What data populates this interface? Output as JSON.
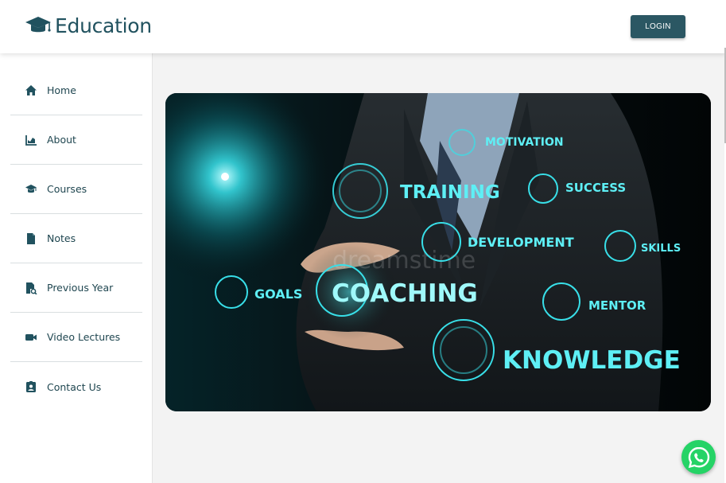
{
  "header": {
    "brand_title": "Education",
    "login_label": "LOGIN"
  },
  "sidebar": {
    "items": [
      {
        "label": "Home",
        "icon": "home-icon"
      },
      {
        "label": "About",
        "icon": "chart-icon"
      },
      {
        "label": "Courses",
        "icon": "graduation-cap-icon"
      },
      {
        "label": "Notes",
        "icon": "file-icon"
      },
      {
        "label": "Previous Year",
        "icon": "file-search-icon"
      },
      {
        "label": "Video Lectures",
        "icon": "video-icon"
      },
      {
        "label": "Contact Us",
        "icon": "contact-card-icon"
      }
    ]
  },
  "hero": {
    "keywords": [
      "MOTIVATION",
      "TRAINING",
      "SUCCESS",
      "DEVELOPMENT",
      "SKILLS",
      "GOALS",
      "COACHING",
      "MENTOR",
      "KNOWLEDGE"
    ],
    "watermark": "dreamstime"
  },
  "colors": {
    "brand": "#21525f",
    "button": "#2b5763",
    "glow": "#35e0e8",
    "whatsapp": "#25d366"
  }
}
